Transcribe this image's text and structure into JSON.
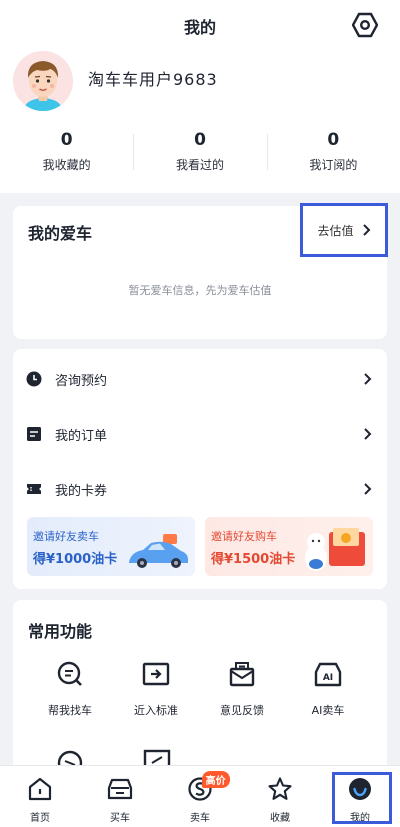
{
  "header": {
    "title": "我的"
  },
  "profile": {
    "username": "淘车车用户9683"
  },
  "stats": [
    {
      "value": "0",
      "label": "我收藏的"
    },
    {
      "value": "0",
      "label": "我看过的"
    },
    {
      "value": "0",
      "label": "我订阅的"
    }
  ],
  "my_car": {
    "title": "我的爱车",
    "valuation_label": "去估值",
    "empty_text": "暂无爱车信息，先为爱车估值"
  },
  "menu": [
    {
      "label": "咨询预约",
      "icon": "clock-icon"
    },
    {
      "label": "我的订单",
      "icon": "order-icon"
    },
    {
      "label": "我的卡券",
      "icon": "ticket-icon"
    }
  ],
  "banners": [
    {
      "line1": "邀请好友卖车",
      "line2": "得¥1000油卡"
    },
    {
      "line1": "邀请好友购车",
      "line2": "得¥1500油卡"
    }
  ],
  "functions": {
    "title": "常用功能",
    "items": [
      {
        "label": "帮我找车",
        "icon": "find-car-icon"
      },
      {
        "label": "近入标准",
        "icon": "standard-icon"
      },
      {
        "label": "意见反馈",
        "icon": "feedback-icon"
      },
      {
        "label": "AI卖车",
        "icon": "ai-sell-icon"
      }
    ]
  },
  "tabbar": [
    {
      "label": "首页",
      "icon": "home-icon"
    },
    {
      "label": "买车",
      "icon": "buy-car-icon"
    },
    {
      "label": "卖车",
      "icon": "sell-car-icon",
      "badge": "高价"
    },
    {
      "label": "收藏",
      "icon": "star-icon"
    },
    {
      "label": "我的",
      "icon": "profile-icon",
      "active": true
    }
  ],
  "colors": {
    "accent": "#3b5bdb",
    "badge": "#ff5a2e",
    "text": "#1e2430",
    "background": "#f1f2f6"
  }
}
